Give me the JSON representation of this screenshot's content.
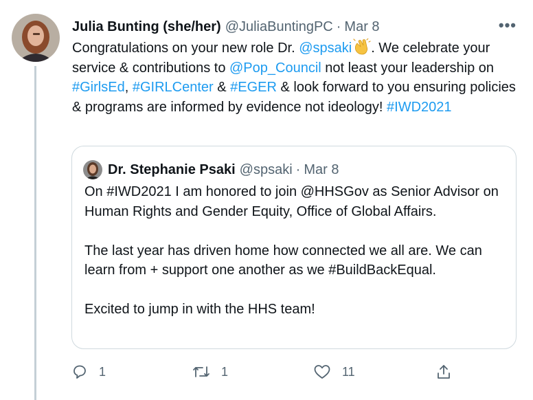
{
  "tweet": {
    "author_name": "Julia Bunting (she/her)",
    "handle": "@JuliaBuntingPC",
    "separator": "·",
    "date": "Mar 8",
    "more_label": "•••",
    "text_parts": {
      "t1": "Congratulations on your new role Dr. ",
      "m1": "@spsaki",
      "t2": ". We celebrate your service & contributions to ",
      "m2": "@Pop_Council",
      "t3": " not least your leadership on ",
      "h1": "#GirlsEd",
      "t4": ", ",
      "h2": "#GIRLCenter",
      "t5": " & ",
      "h3": "#EGER",
      "t6": " & look forward to you ensuring policies & programs are informed by evidence not ideology! ",
      "h4": "#IWD2021"
    },
    "emoji_icon": "clapping-hands-icon"
  },
  "quoted_tweet": {
    "author_name": "Dr. Stephanie Psaki",
    "handle": "@spsaki",
    "separator": "·",
    "date": "Mar 8",
    "paragraphs": [
      "On #IWD2021 I am honored to join @HHSGov as Senior Advisor on Human Rights and Gender Equity, Office of Global Affairs.",
      "The last year has driven home how connected we all are. We can learn from + support one another as we #BuildBackEqual.",
      "Excited to jump in with the HHS team!"
    ]
  },
  "actions": {
    "reply_count": "1",
    "retweet_count": "1",
    "like_count": "11",
    "icons": [
      "reply-icon",
      "retweet-icon",
      "like-icon",
      "share-icon"
    ]
  },
  "colors": {
    "text": "#0f1419",
    "secondary": "#536471",
    "link": "#1d9bf0",
    "border": "#cfd9de",
    "thread_line": "#c4cfd6"
  }
}
